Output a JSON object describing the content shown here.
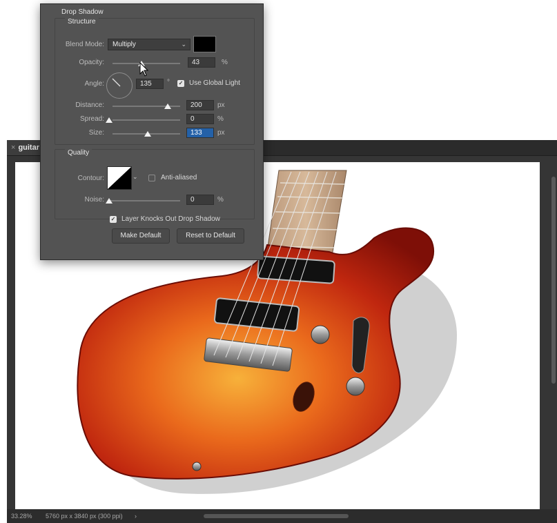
{
  "document": {
    "tab_title": "guitar",
    "zoom": "33.28%",
    "doc_info": "5760 px x 3840 px (300 ppi)",
    "status_arrow": "›"
  },
  "dialog": {
    "section_title": "Drop Shadow",
    "structure": {
      "label": "Structure",
      "blend_mode_label": "Blend Mode:",
      "blend_mode_value": "Multiply",
      "shadow_color": "#000000",
      "opacity_label": "Opacity:",
      "opacity_value": "43",
      "opacity_unit": "%",
      "opacity_fraction": 0.43,
      "angle_label": "Angle:",
      "angle_value": "135",
      "angle_unit": "°",
      "use_global_light_label": "Use Global Light",
      "use_global_light": true,
      "distance_label": "Distance:",
      "distance_value": "200",
      "distance_unit": "px",
      "spread_label": "Spread:",
      "spread_value": "0",
      "spread_unit": "%",
      "size_label": "Size:",
      "size_value": "133",
      "size_unit": "px"
    },
    "quality": {
      "label": "Quality",
      "contour_label": "Contour:",
      "anti_aliased_label": "Anti-aliased",
      "anti_aliased": false,
      "noise_label": "Noise:",
      "noise_value": "0",
      "noise_unit": "%"
    },
    "layer_knocks_out_label": "Layer Knocks Out Drop Shadow",
    "layer_knocks_out": true,
    "make_default_label": "Make Default",
    "reset_default_label": "Reset to Default"
  },
  "icons": {
    "close": "close-icon",
    "chevron": "chevron-down-icon",
    "check": "checkmark-icon",
    "cursor": "pointer-cursor-icon"
  }
}
